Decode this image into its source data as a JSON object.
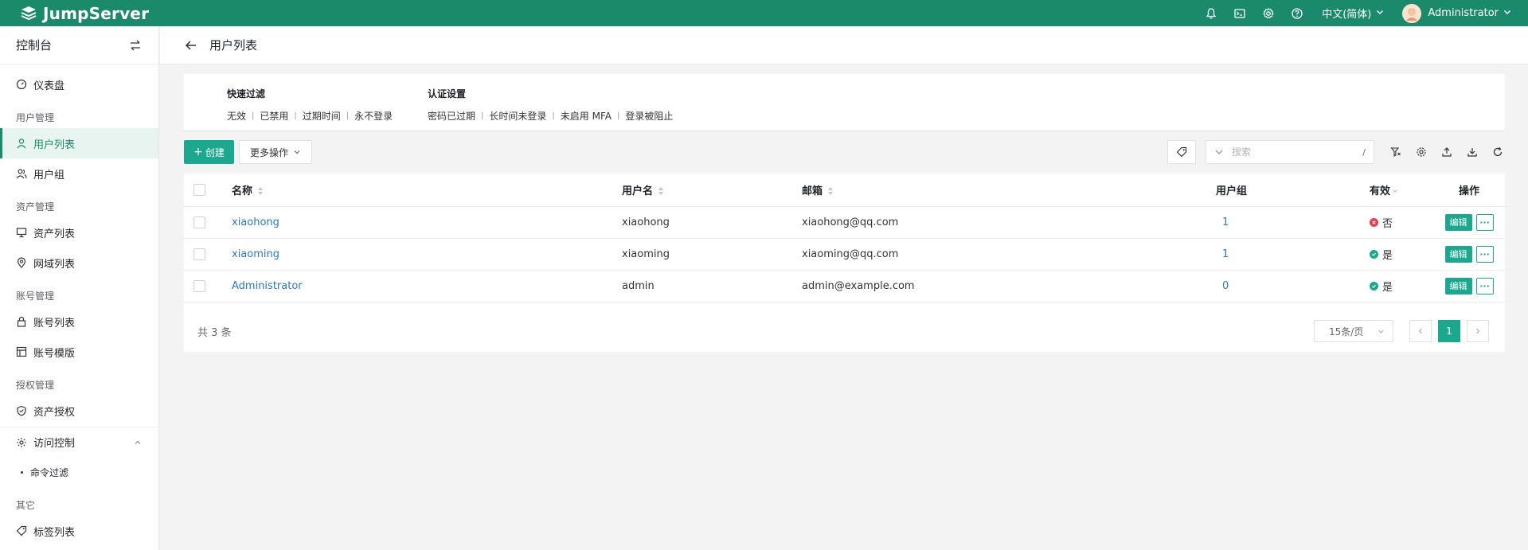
{
  "colors": {
    "brand": "#1b8a6b",
    "accent": "#1ba88e",
    "link": "#2a78c8",
    "error": "#e0414f",
    "success": "#1ba88e"
  },
  "topbar": {
    "app_name": "JumpServer",
    "icons": [
      "bell-icon",
      "terminal-icon",
      "gear-icon",
      "help-icon"
    ],
    "language": "中文(简体)",
    "username": "Administrator"
  },
  "sidebar": {
    "title": "控制台",
    "dashboard": "仪表盘",
    "group_user": "用户管理",
    "user_list": "用户列表",
    "user_group": "用户组",
    "group_asset": "资产管理",
    "asset_list": "资产列表",
    "domain_list": "网域列表",
    "group_account": "账号管理",
    "account_list": "账号列表",
    "account_template": "账号模版",
    "group_perm": "授权管理",
    "asset_perm": "资产授权",
    "access_control": "访问控制",
    "command_filter": "命令过滤",
    "group_other": "其它",
    "tag_list": "标签列表"
  },
  "page": {
    "title": "用户列表"
  },
  "filters": {
    "quick": {
      "title": "快速过滤",
      "items": [
        "无效",
        "已禁用",
        "过期时间",
        "永不登录"
      ]
    },
    "auth": {
      "title": "认证设置",
      "items": [
        "密码已过期",
        "长时间未登录",
        "未启用 MFA",
        "登录被阻止"
      ]
    }
  },
  "toolbar": {
    "create": "创建",
    "more": "更多操作",
    "search_placeholder": "搜索",
    "search_shortcut": "/"
  },
  "table": {
    "headers": {
      "name": "名称",
      "username": "用户名",
      "email": "邮箱",
      "groups": "用户组",
      "active": "有效",
      "actions": "操作"
    },
    "rows": [
      {
        "name": "xiaohong",
        "username": "xiaohong",
        "email": "xiaohong@qq.com",
        "groups": "1",
        "active": "否",
        "active_state": "no"
      },
      {
        "name": "xiaoming",
        "username": "xiaoming",
        "email": "xiaoming@qq.com",
        "groups": "1",
        "active": "是",
        "active_state": "yes"
      },
      {
        "name": "Administrator",
        "username": "admin",
        "email": "admin@example.com",
        "groups": "0",
        "active": "是",
        "active_state": "yes"
      }
    ],
    "edit_label": "编辑",
    "more_label": "···"
  },
  "pagination": {
    "total": "共 3 条",
    "page_size": "15条/页",
    "current_page": "1"
  }
}
